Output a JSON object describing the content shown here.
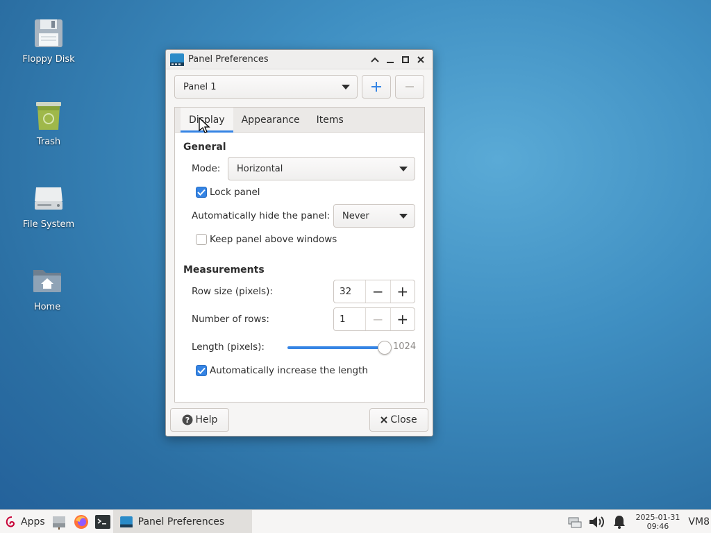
{
  "desktop": {
    "icons": [
      {
        "label": "Floppy Disk",
        "icon": "floppy-disk-icon"
      },
      {
        "label": "Trash",
        "icon": "trash-icon"
      },
      {
        "label": "File System",
        "icon": "drive-icon"
      },
      {
        "label": "Home",
        "icon": "home-folder-icon"
      }
    ]
  },
  "window": {
    "title": "Panel Preferences",
    "panel_select": "Panel 1",
    "tabs": [
      "Display",
      "Appearance",
      "Items"
    ],
    "active_tab": "Display",
    "general": {
      "title": "General",
      "mode_label": "Mode:",
      "mode_value": "Horizontal",
      "lock_panel": {
        "label": "Lock panel",
        "checked": true
      },
      "autohide_label": "Automatically hide the panel:",
      "autohide_value": "Never",
      "keep_above": {
        "label": "Keep panel above windows",
        "checked": false
      }
    },
    "measurements": {
      "title": "Measurements",
      "row_size_label": "Row size (pixels):",
      "row_size_value": "32",
      "rows_label": "Number of rows:",
      "rows_value": "1",
      "length_label": "Length (pixels):",
      "length_value": "1024",
      "length_fraction": 1.0,
      "auto_length": {
        "label": "Automatically increase the length",
        "checked": true
      }
    },
    "help_label": "Help",
    "close_label": "Close"
  },
  "taskbar": {
    "apps_label": "Apps",
    "task_label": "Panel Preferences",
    "date": "2025-01-31",
    "time": "09:46",
    "workspace": "VM8"
  },
  "colors": {
    "accent": "#3584e4",
    "desktop": "#3f8fc2"
  }
}
